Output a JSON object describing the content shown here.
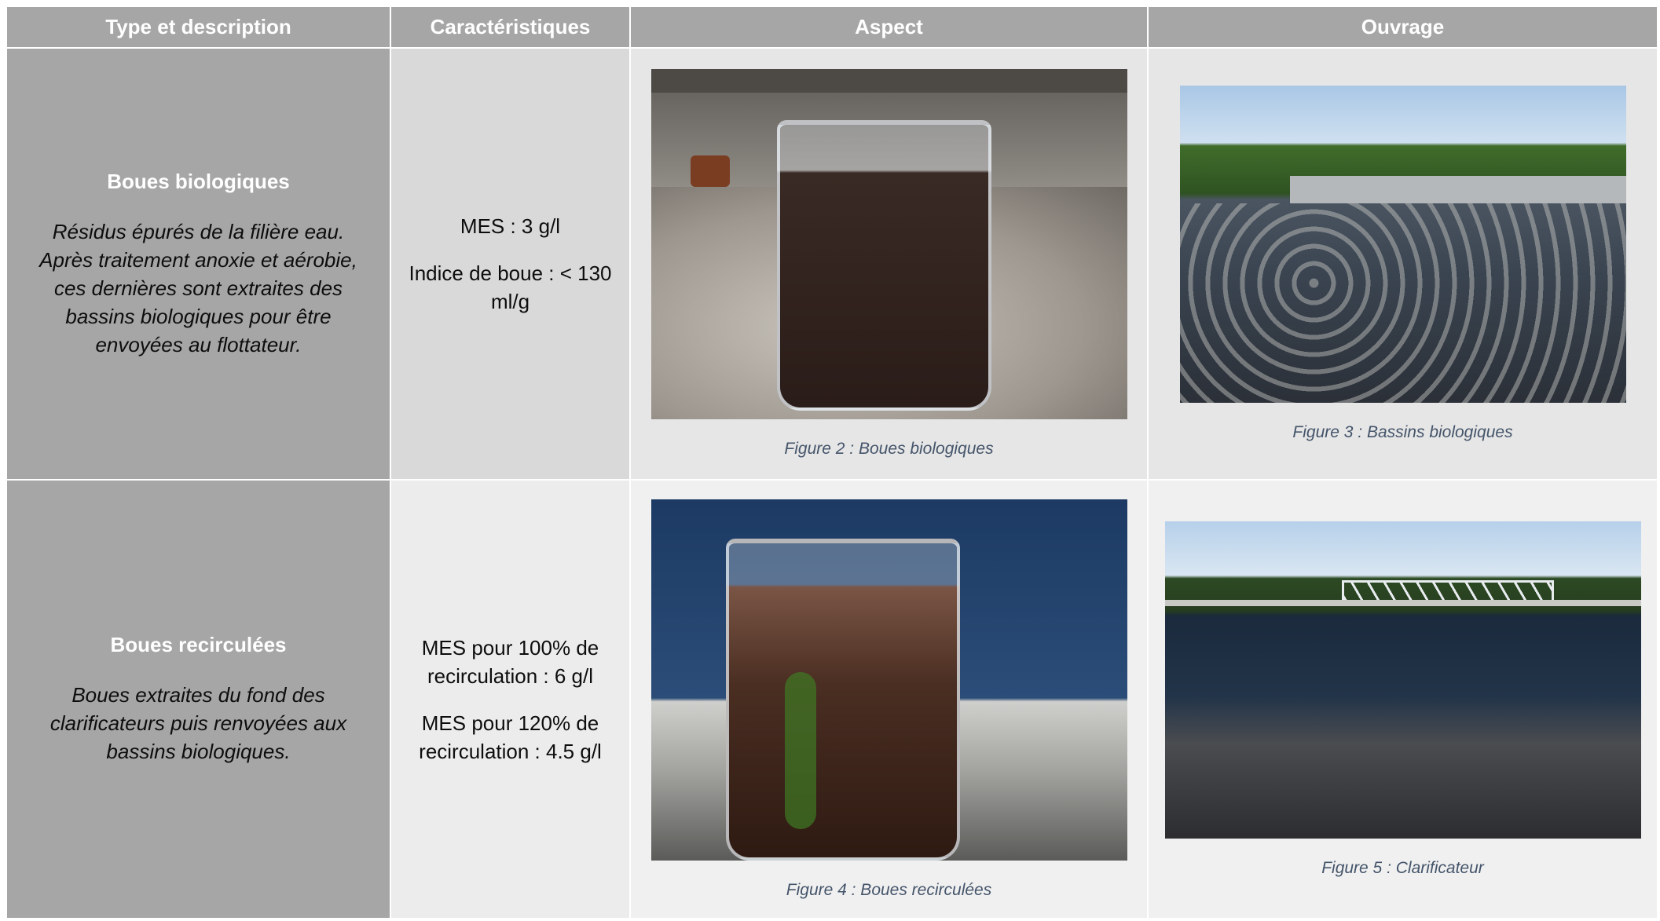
{
  "headers": {
    "type": "Type et description",
    "caracteristiques": "Caractéristiques",
    "aspect": "Aspect",
    "ouvrage": "Ouvrage"
  },
  "rows": [
    {
      "title": "Boues biologiques",
      "description": "Résidus épurés de la filière eau. Après traitement anoxie et aérobie, ces dernières sont extraites des bassins biologiques pour être envoyées au flottateur.",
      "caracteristiques": [
        "MES : 3 g/l",
        "Indice de boue : < 130 ml/g"
      ],
      "aspect_caption": "Figure 2 : Boues biologiques",
      "ouvrage_caption": "Figure 3 : Bassins biologiques"
    },
    {
      "title": "Boues recirculées",
      "description": "Boues extraites du fond des clarificateurs puis renvoyées aux bassins biologiques.",
      "caracteristiques": [
        "MES pour 100% de recirculation : 6 g/l",
        "MES pour 120% de recirculation : 4.5 g/l"
      ],
      "aspect_caption": "Figure 4 : Boues recirculées",
      "ouvrage_caption": "Figure 5 : Clarificateur"
    }
  ]
}
